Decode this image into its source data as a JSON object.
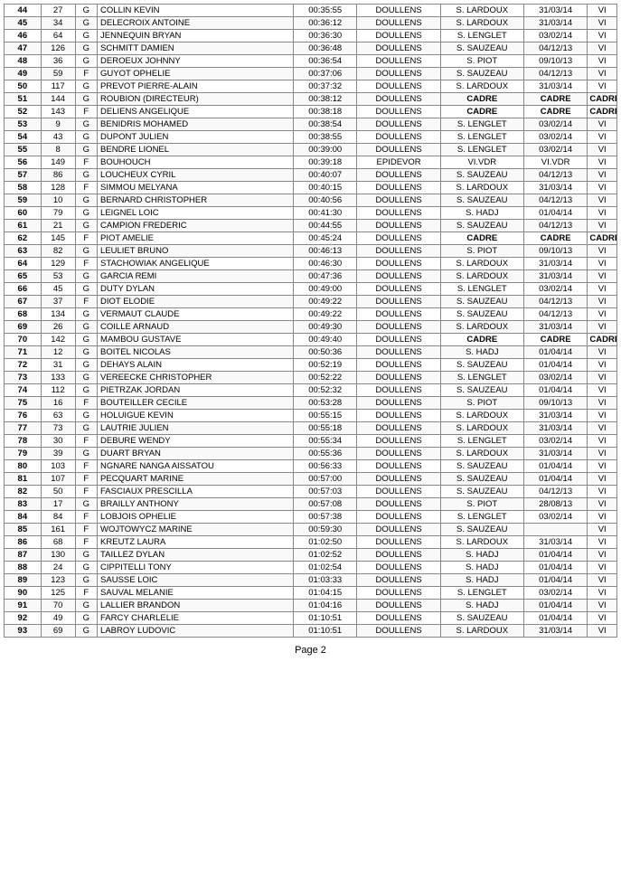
{
  "page": {
    "footer": "Page 2",
    "headers": [
      "",
      "",
      "",
      "",
      "",
      "DOULLENS",
      "",
      "",
      ""
    ]
  },
  "rows": [
    {
      "rank": "44",
      "doss": "27",
      "sex": "G",
      "name": "COLLIN KEVIN",
      "time": "00:35:55",
      "club": "DOULLENS",
      "coach": "S. LARDOUX",
      "date": "31/03/14",
      "cat": "VI"
    },
    {
      "rank": "45",
      "doss": "34",
      "sex": "G",
      "name": "DELECROIX ANTOINE",
      "time": "00:36:12",
      "club": "DOULLENS",
      "coach": "S. LARDOUX",
      "date": "31/03/14",
      "cat": "VI"
    },
    {
      "rank": "46",
      "doss": "64",
      "sex": "G",
      "name": "JENNEQUIN BRYAN",
      "time": "00:36:30",
      "club": "DOULLENS",
      "coach": "S. LENGLET",
      "date": "03/02/14",
      "cat": "VI"
    },
    {
      "rank": "47",
      "doss": "126",
      "sex": "G",
      "name": "SCHMITT DAMIEN",
      "time": "00:36:48",
      "club": "DOULLENS",
      "coach": "S. SAUZEAU",
      "date": "04/12/13",
      "cat": "VI"
    },
    {
      "rank": "48",
      "doss": "36",
      "sex": "G",
      "name": "DEROEUX JOHNNY",
      "time": "00:36:54",
      "club": "DOULLENS",
      "coach": "S. PIOT",
      "date": "09/10/13",
      "cat": "VI"
    },
    {
      "rank": "49",
      "doss": "59",
      "sex": "F",
      "name": "GUYOT OPHELIE",
      "time": "00:37:06",
      "club": "DOULLENS",
      "coach": "S. SAUZEAU",
      "date": "04/12/13",
      "cat": "VI"
    },
    {
      "rank": "50",
      "doss": "117",
      "sex": "G",
      "name": "PREVOT PIERRE-ALAIN",
      "time": "00:37:32",
      "club": "DOULLENS",
      "coach": "S. LARDOUX",
      "date": "31/03/14",
      "cat": "VI"
    },
    {
      "rank": "51",
      "doss": "144",
      "sex": "G",
      "name": "ROUBION (DIRECTEUR)",
      "time": "00:38:12",
      "club": "DOULLENS",
      "coach": "CADRE",
      "date": "CADRE",
      "cat": "CADRE"
    },
    {
      "rank": "52",
      "doss": "143",
      "sex": "F",
      "name": "DELIENS ANGELIQUE",
      "time": "00:38:18",
      "club": "DOULLENS",
      "coach": "CADRE",
      "date": "CADRE",
      "cat": "CADRE"
    },
    {
      "rank": "53",
      "doss": "9",
      "sex": "G",
      "name": "BENIDRIS MOHAMED",
      "time": "00:38:54",
      "club": "DOULLENS",
      "coach": "S. LENGLET",
      "date": "03/02/14",
      "cat": "VI"
    },
    {
      "rank": "54",
      "doss": "43",
      "sex": "G",
      "name": "DUPONT JULIEN",
      "time": "00:38:55",
      "club": "DOULLENS",
      "coach": "S. LENGLET",
      "date": "03/02/14",
      "cat": "VI"
    },
    {
      "rank": "55",
      "doss": "8",
      "sex": "G",
      "name": "BENDRE LIONEL",
      "time": "00:39:00",
      "club": "DOULLENS",
      "coach": "S. LENGLET",
      "date": "03/02/14",
      "cat": "VI"
    },
    {
      "rank": "56",
      "doss": "149",
      "sex": "F",
      "name": "BOUHOUCH",
      "time": "00:39:18",
      "club": "EPIDEVOR",
      "coach": "VI.VDR",
      "date": "VI.VDR",
      "cat": "VI"
    },
    {
      "rank": "57",
      "doss": "86",
      "sex": "G",
      "name": "LOUCHEUX CYRIL",
      "time": "00:40:07",
      "club": "DOULLENS",
      "coach": "S. SAUZEAU",
      "date": "04/12/13",
      "cat": "VI"
    },
    {
      "rank": "58",
      "doss": "128",
      "sex": "F",
      "name": "SIMMOU MELYANA",
      "time": "00:40:15",
      "club": "DOULLENS",
      "coach": "S. LARDOUX",
      "date": "31/03/14",
      "cat": "VI"
    },
    {
      "rank": "59",
      "doss": "10",
      "sex": "G",
      "name": "BERNARD CHRISTOPHER",
      "time": "00:40:56",
      "club": "DOULLENS",
      "coach": "S. SAUZEAU",
      "date": "04/12/13",
      "cat": "VI"
    },
    {
      "rank": "60",
      "doss": "79",
      "sex": "G",
      "name": "LEIGNEL LOIC",
      "time": "00:41:30",
      "club": "DOULLENS",
      "coach": "S. HADJ",
      "date": "01/04/14",
      "cat": "VI"
    },
    {
      "rank": "61",
      "doss": "21",
      "sex": "G",
      "name": "CAMPION FREDERIC",
      "time": "00:44:55",
      "club": "DOULLENS",
      "coach": "S. SAUZEAU",
      "date": "04/12/13",
      "cat": "VI"
    },
    {
      "rank": "62",
      "doss": "145",
      "sex": "F",
      "name": "PIOT AMELIE",
      "time": "00:45:24",
      "club": "DOULLENS",
      "coach": "CADRE",
      "date": "CADRE",
      "cat": "CADRE"
    },
    {
      "rank": "63",
      "doss": "82",
      "sex": "G",
      "name": "LEULIET BRUNO",
      "time": "00:46:13",
      "club": "DOULLENS",
      "coach": "S. PIOT",
      "date": "09/10/13",
      "cat": "VI"
    },
    {
      "rank": "64",
      "doss": "129",
      "sex": "F",
      "name": "STACHOWIAK ANGELIQUE",
      "time": "00:46:30",
      "club": "DOULLENS",
      "coach": "S. LARDOUX",
      "date": "31/03/14",
      "cat": "VI"
    },
    {
      "rank": "65",
      "doss": "53",
      "sex": "G",
      "name": "GARCIA REMI",
      "time": "00:47:36",
      "club": "DOULLENS",
      "coach": "S. LARDOUX",
      "date": "31/03/14",
      "cat": "VI"
    },
    {
      "rank": "66",
      "doss": "45",
      "sex": "G",
      "name": "DUTY DYLAN",
      "time": "00:49:00",
      "club": "DOULLENS",
      "coach": "S. LENGLET",
      "date": "03/02/14",
      "cat": "VI"
    },
    {
      "rank": "67",
      "doss": "37",
      "sex": "F",
      "name": "DIOT ELODIE",
      "time": "00:49:22",
      "club": "DOULLENS",
      "coach": "S. SAUZEAU",
      "date": "04/12/13",
      "cat": "VI"
    },
    {
      "rank": "68",
      "doss": "134",
      "sex": "G",
      "name": "VERMAUT CLAUDE",
      "time": "00:49:22",
      "club": "DOULLENS",
      "coach": "S. SAUZEAU",
      "date": "04/12/13",
      "cat": "VI"
    },
    {
      "rank": "69",
      "doss": "26",
      "sex": "G",
      "name": "COILLE ARNAUD",
      "time": "00:49:30",
      "club": "DOULLENS",
      "coach": "S. LARDOUX",
      "date": "31/03/14",
      "cat": "VI"
    },
    {
      "rank": "70",
      "doss": "142",
      "sex": "G",
      "name": "MAMBOU GUSTAVE",
      "time": "00:49:40",
      "club": "DOULLENS",
      "coach": "CADRE",
      "date": "CADRE",
      "cat": "CADRE"
    },
    {
      "rank": "71",
      "doss": "12",
      "sex": "G",
      "name": "BOITEL NICOLAS",
      "time": "00:50:36",
      "club": "DOULLENS",
      "coach": "S. HADJ",
      "date": "01/04/14",
      "cat": "VI"
    },
    {
      "rank": "72",
      "doss": "31",
      "sex": "G",
      "name": "DEHAYS ALAIN",
      "time": "00:52:19",
      "club": "DOULLENS",
      "coach": "S. SAUZEAU",
      "date": "01/04/14",
      "cat": "VI"
    },
    {
      "rank": "73",
      "doss": "133",
      "sex": "G",
      "name": "VEREECKE CHRISTOPHER",
      "time": "00:52:22",
      "club": "DOULLENS",
      "coach": "S. LENGLET",
      "date": "03/02/14",
      "cat": "VI"
    },
    {
      "rank": "74",
      "doss": "112",
      "sex": "G",
      "name": "PIETRZAK JORDAN",
      "time": "00:52:32",
      "club": "DOULLENS",
      "coach": "S. SAUZEAU",
      "date": "01/04/14",
      "cat": "VI"
    },
    {
      "rank": "75",
      "doss": "16",
      "sex": "F",
      "name": "BOUTEILLER CECILE",
      "time": "00:53:28",
      "club": "DOULLENS",
      "coach": "S. PIOT",
      "date": "09/10/13",
      "cat": "VI"
    },
    {
      "rank": "76",
      "doss": "63",
      "sex": "G",
      "name": "HOLUIGUE KEVIN",
      "time": "00:55:15",
      "club": "DOULLENS",
      "coach": "S. LARDOUX",
      "date": "31/03/14",
      "cat": "VI"
    },
    {
      "rank": "77",
      "doss": "73",
      "sex": "G",
      "name": "LAUTRIE JULIEN",
      "time": "00:55:18",
      "club": "DOULLENS",
      "coach": "S. LARDOUX",
      "date": "31/03/14",
      "cat": "VI"
    },
    {
      "rank": "78",
      "doss": "30",
      "sex": "F",
      "name": "DEBURE WENDY",
      "time": "00:55:34",
      "club": "DOULLENS",
      "coach": "S. LENGLET",
      "date": "03/02/14",
      "cat": "VI"
    },
    {
      "rank": "79",
      "doss": "39",
      "sex": "G",
      "name": "DUART BRYAN",
      "time": "00:55:36",
      "club": "DOULLENS",
      "coach": "S. LARDOUX",
      "date": "31/03/14",
      "cat": "VI"
    },
    {
      "rank": "80",
      "doss": "103",
      "sex": "F",
      "name": "NGNARE NANGA AISSATOU",
      "time": "00:56:33",
      "club": "DOULLENS",
      "coach": "S. SAUZEAU",
      "date": "01/04/14",
      "cat": "VI"
    },
    {
      "rank": "81",
      "doss": "107",
      "sex": "F",
      "name": "PECQUART MARINE",
      "time": "00:57:00",
      "club": "DOULLENS",
      "coach": "S. SAUZEAU",
      "date": "01/04/14",
      "cat": "VI"
    },
    {
      "rank": "82",
      "doss": "50",
      "sex": "F",
      "name": "FASCIAUX PRESCILLA",
      "time": "00:57:03",
      "club": "DOULLENS",
      "coach": "S. SAUZEAU",
      "date": "04/12/13",
      "cat": "VI"
    },
    {
      "rank": "83",
      "doss": "17",
      "sex": "G",
      "name": "BRAILLY ANTHONY",
      "time": "00:57:08",
      "club": "DOULLENS",
      "coach": "S. PIOT",
      "date": "28/08/13",
      "cat": "VI"
    },
    {
      "rank": "84",
      "doss": "84",
      "sex": "F",
      "name": "LOBJOIS OPHELIE",
      "time": "00:57:38",
      "club": "DOULLENS",
      "coach": "S. LENGLET",
      "date": "03/02/14",
      "cat": "VI"
    },
    {
      "rank": "85",
      "doss": "161",
      "sex": "F",
      "name": "WOJTOWYCZ MARINE",
      "time": "00:59:30",
      "club": "DOULLENS",
      "coach": "S. SAUZEAU",
      "date": "",
      "cat": "VI"
    },
    {
      "rank": "86",
      "doss": "68",
      "sex": "F",
      "name": "KREUTZ LAURA",
      "time": "01:02:50",
      "club": "DOULLENS",
      "coach": "S. LARDOUX",
      "date": "31/03/14",
      "cat": "VI"
    },
    {
      "rank": "87",
      "doss": "130",
      "sex": "G",
      "name": "TAILLEZ DYLAN",
      "time": "01:02:52",
      "club": "DOULLENS",
      "coach": "S. HADJ",
      "date": "01/04/14",
      "cat": "VI"
    },
    {
      "rank": "88",
      "doss": "24",
      "sex": "G",
      "name": "CIPPITELLI TONY",
      "time": "01:02:54",
      "club": "DOULLENS",
      "coach": "S. HADJ",
      "date": "01/04/14",
      "cat": "VI"
    },
    {
      "rank": "89",
      "doss": "123",
      "sex": "G",
      "name": "SAUSSE LOIC",
      "time": "01:03:33",
      "club": "DOULLENS",
      "coach": "S. HADJ",
      "date": "01/04/14",
      "cat": "VI"
    },
    {
      "rank": "90",
      "doss": "125",
      "sex": "F",
      "name": "SAUVAL MELANIE",
      "time": "01:04:15",
      "club": "DOULLENS",
      "coach": "S. LENGLET",
      "date": "03/02/14",
      "cat": "VI"
    },
    {
      "rank": "91",
      "doss": "70",
      "sex": "G",
      "name": "LALLIER BRANDON",
      "time": "01:04:16",
      "club": "DOULLENS",
      "coach": "S. HADJ",
      "date": "01/04/14",
      "cat": "VI"
    },
    {
      "rank": "92",
      "doss": "49",
      "sex": "G",
      "name": "FARCY CHARLELIE",
      "time": "01:10:51",
      "club": "DOULLENS",
      "coach": "S. SAUZEAU",
      "date": "01/04/14",
      "cat": "VI"
    },
    {
      "rank": "93",
      "doss": "69",
      "sex": "G",
      "name": "LABROY LUDOVIC",
      "time": "01:10:51",
      "club": "DOULLENS",
      "coach": "S. LARDOUX",
      "date": "31/03/14",
      "cat": "VI"
    }
  ]
}
